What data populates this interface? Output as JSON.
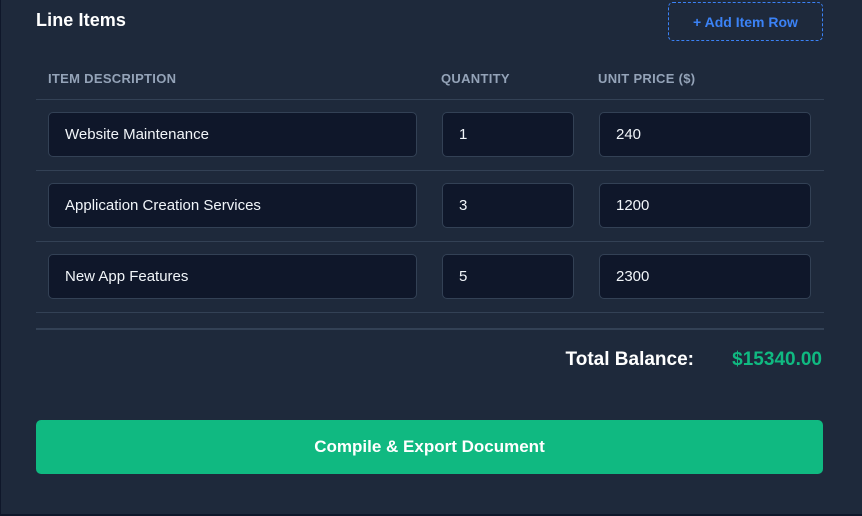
{
  "line_items": {
    "title": "Line Items",
    "add_row_label": "+ Add Item Row",
    "headers": {
      "description": "ITEM DESCRIPTION",
      "quantity": "QUANTITY",
      "unit_price": "UNIT PRICE ($)"
    },
    "rows": [
      {
        "description": "Website Maintenance",
        "quantity": "1",
        "unit_price": "240"
      },
      {
        "description": "Application Creation Services",
        "quantity": "3",
        "unit_price": "1200"
      },
      {
        "description": "New App Features",
        "quantity": "5",
        "unit_price": "2300"
      }
    ]
  },
  "summary": {
    "total_label": "Total Balance:",
    "total_value": "$15340.00"
  },
  "actions": {
    "export_label": "Compile & Export Document"
  },
  "colors": {
    "background": "#1e293b",
    "input_background": "#0f172a",
    "accent_blue": "#3b82f6",
    "accent_green": "#10b981",
    "header_text": "#94a3b8"
  }
}
